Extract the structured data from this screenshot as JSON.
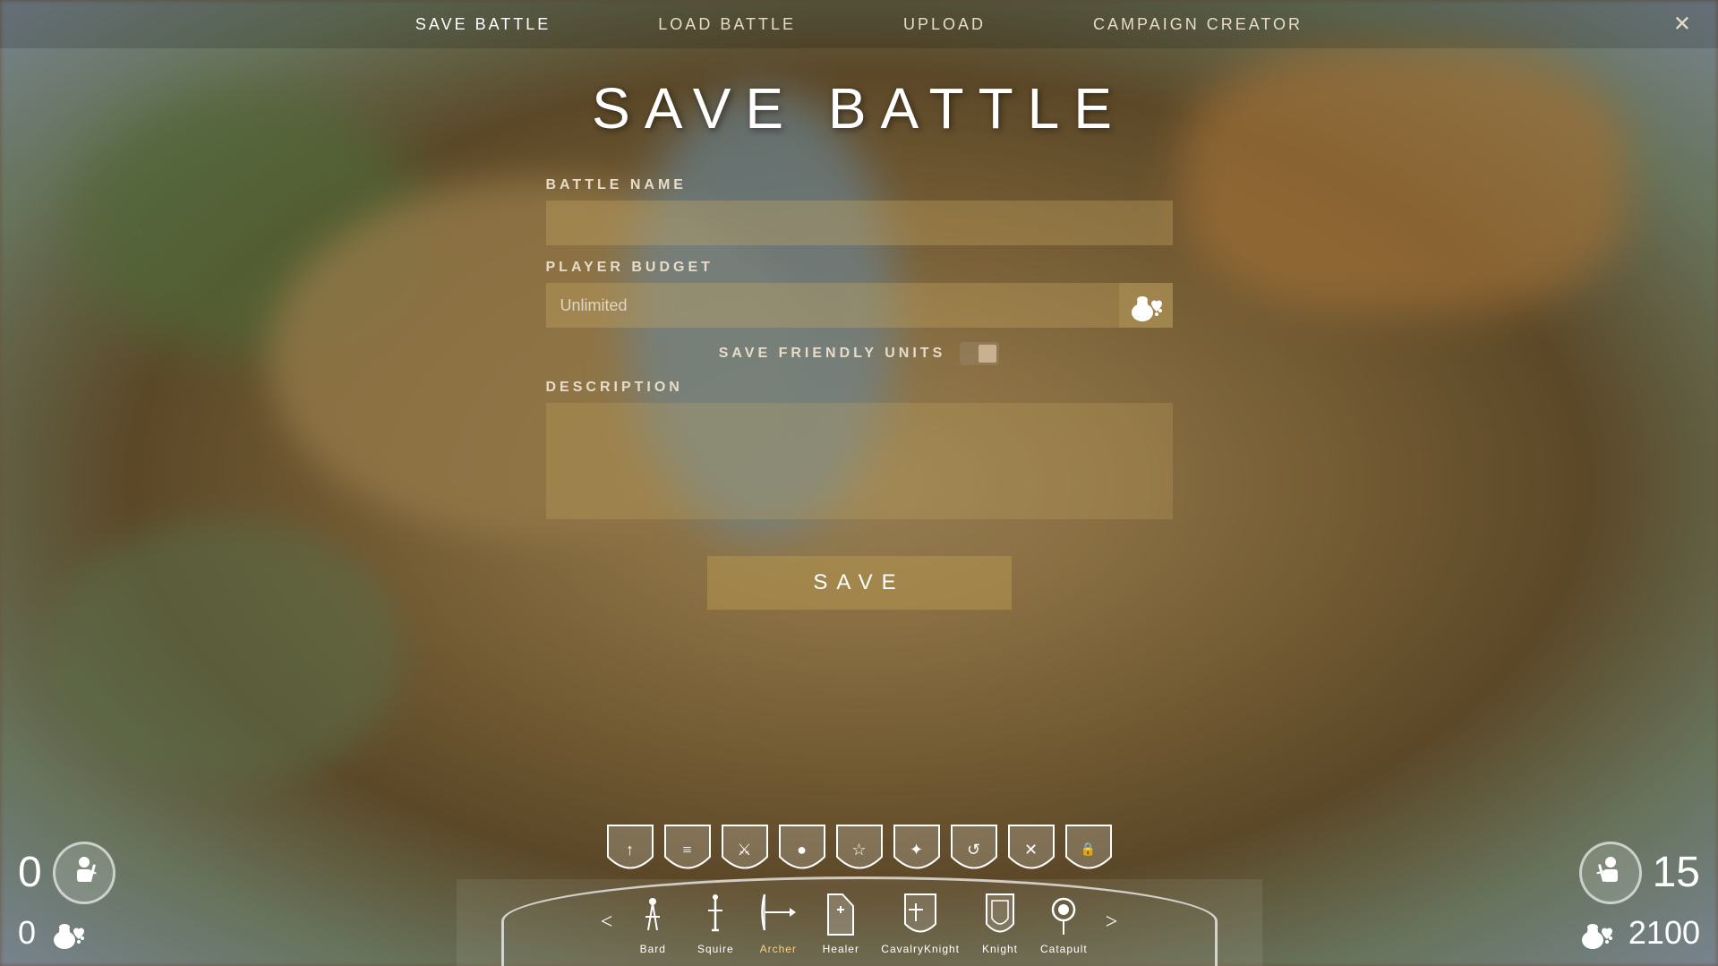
{
  "nav": {
    "save_battle": "Save Battle",
    "load_battle": "Load Battle",
    "upload": "Upload",
    "campaign_creator": "Campaign Creator",
    "close": "✕",
    "active": "save_battle"
  },
  "form": {
    "title": "SAVE BATTLE",
    "battle_name_label": "BATTLE NAME",
    "battle_name_placeholder": "",
    "player_budget_label": "PLAYER BUDGET",
    "player_budget_value": "Unlimited",
    "save_friendly_label": "SAVE FRIENDLY UNITS",
    "description_label": "DESCRIPTION",
    "description_value": "",
    "save_button_label": "SAVE"
  },
  "hud": {
    "left_score_top": "0",
    "left_score_bottom": "0",
    "right_score_top": "15",
    "right_score_bottom": "2100",
    "nav_left": "<",
    "nav_right": ">",
    "units": [
      {
        "name": "Bard",
        "icon": "♪",
        "active": false
      },
      {
        "name": "Squire",
        "icon": "⚔",
        "active": false
      },
      {
        "name": "Archer",
        "icon": "🏹",
        "active": true
      },
      {
        "name": "Healer",
        "icon": "✚",
        "active": false
      },
      {
        "name": "CavalryKnight",
        "icon": "🛡",
        "active": false
      },
      {
        "name": "Knight",
        "icon": "🛡",
        "active": false
      },
      {
        "name": "Catapult",
        "icon": "●",
        "active": false
      }
    ],
    "shield_icons": [
      "↑",
      "≡",
      "⚔",
      "●",
      "☆",
      "✦",
      "↺",
      "✕",
      "🔒"
    ]
  }
}
